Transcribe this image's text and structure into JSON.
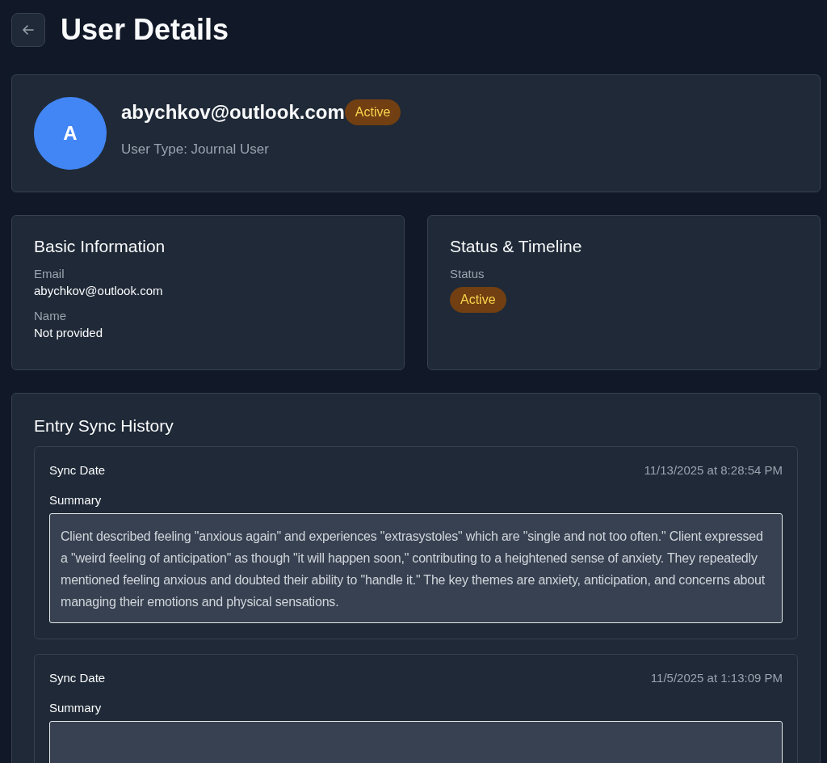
{
  "header": {
    "title": "User Details"
  },
  "profile": {
    "initial": "A",
    "email": "abychkov@outlook.com",
    "status": "Active",
    "user_type": "User Type: Journal User"
  },
  "basic_information": {
    "title": "Basic Information",
    "fields": [
      {
        "label": "Email",
        "value": "abychkov@outlook.com"
      },
      {
        "label": "Name",
        "value": "Not provided"
      }
    ]
  },
  "status_timeline": {
    "title": "Status & Timeline",
    "status_label": "Status",
    "status": "Active"
  },
  "sync_history": {
    "title": "Entry Sync History",
    "entries": [
      {
        "date_label": "Sync Date",
        "date": "11/13/2025 at 8:28:54 PM",
        "summary_label": "Summary",
        "summary": "Client described feeling \"anxious again\" and experiences \"extrasystoles\" which are \"single and not too often.\" Client expressed a \"weird feeling of anticipation\" as though \"it will happen soon,\" contributing to a heightened sense of anxiety. They repeatedly mentioned feeling anxious and doubted their ability to \"handle it.\" The key themes are anxiety, anticipation, and concerns about managing their emotions and physical sensations."
      },
      {
        "date_label": "Sync Date",
        "date": "11/5/2025 at 1:13:09 PM",
        "summary_label": "Summary"
      }
    ]
  }
}
